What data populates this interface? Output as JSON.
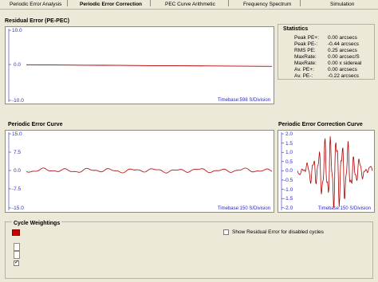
{
  "tabs": [
    {
      "label": "Periodic Error Analysis"
    },
    {
      "label": "Periodic Error Correction"
    },
    {
      "label": "PEC Curve Arithmetic"
    },
    {
      "label": "Frequency Spectrum"
    },
    {
      "label": "Simulation"
    }
  ],
  "residual": {
    "title": "Residual Error (PE-PEC)",
    "ticks": [
      "10.0",
      "0.0",
      "-10.0"
    ],
    "timebase": "Timebase:598 S/Division"
  },
  "statistics": {
    "title": "Statistics",
    "rows": [
      {
        "label": "Peak PE+:",
        "value": "0.00 arcsecs"
      },
      {
        "label": "Peak PE-:",
        "value": "-0.44 arcsecs"
      },
      {
        "label": "RMS PE:",
        "value": "0.25 arcsecs"
      },
      {
        "label": "MaxRate:",
        "value": "0.00 arcsec/S"
      },
      {
        "label": "MaxRate:",
        "value": "0.00 x sidereal"
      },
      {
        "label": "Av. PE+:",
        "value": "0.00 arcsecs"
      },
      {
        "label": "Av. PE-:",
        "value": "-0.22 arcsecs"
      }
    ]
  },
  "pec_curve": {
    "title": "Periodic Error Curve",
    "ticks": [
      "15.0",
      "7.5",
      "0.0",
      "-7.5",
      "-15.0"
    ],
    "timebase": "Timebase:150 S/Division"
  },
  "pec_correction": {
    "title": "Periodic Error Correction Curve",
    "ticks": [
      "2.0",
      "1.5",
      "1.0",
      "0.5",
      "0.0",
      "-0.5",
      "-1.0",
      "-1.5",
      "-2.0"
    ],
    "timebase": "Timebase:150 S/Division"
  },
  "cycle_weightings": {
    "title": "Cycle Weightings",
    "checkbox_label": "Show Residual Error for disabled cycles",
    "swatch_color": "#cc0000"
  },
  "colors": {
    "trace": "#b00000",
    "tick": "#2a2ac0"
  }
}
